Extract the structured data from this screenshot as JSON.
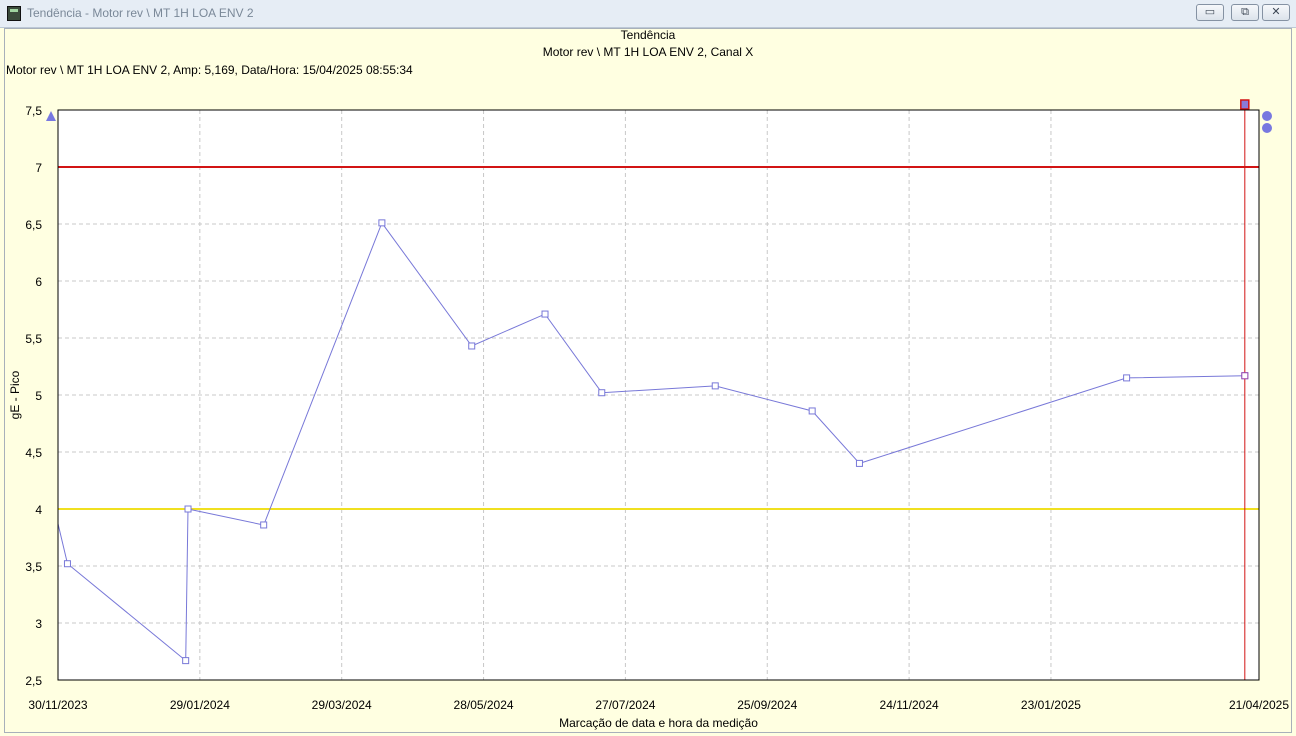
{
  "window": {
    "title": "Tendência - Motor rev \\ MT 1H LOA ENV 2",
    "minimize_glyph": "▭",
    "restore_glyph": "⧉",
    "close_glyph": "✕"
  },
  "header": {
    "title": "Tendência",
    "subtitle": "Motor rev \\ MT 1H LOA ENV 2, Canal X",
    "readout": "Motor rev \\ MT 1H LOA ENV 2, Amp: 5,169, Data/Hora: 15/04/2025 08:55:34"
  },
  "colors": {
    "background": "#FFFFE1",
    "plot_background": "#FFFFFF",
    "series": "#7878D8",
    "alarm_high": "#D21414",
    "alarm_warning": "#F0E020",
    "cursor": "#D21414",
    "grid": "#C8C8C8"
  },
  "chart_data": {
    "type": "line",
    "title": "Tendência",
    "subtitle": "Motor rev \\ MT 1H LOA ENV 2, Canal X",
    "xlabel": "Marcação de data e hora da medição",
    "ylabel": "gE - Pico",
    "xlim": [
      "2023-11-30",
      "2025-04-21"
    ],
    "ylim": [
      2.5,
      7.5
    ],
    "x_tick_labels": [
      "30/11/2023",
      "29/01/2024",
      "29/03/2024",
      "28/05/2024",
      "27/07/2024",
      "25/09/2024",
      "24/11/2024",
      "23/01/2025",
      "21/04/2025"
    ],
    "y_tick_labels": [
      "2,5",
      "3",
      "3,5",
      "4",
      "4,5",
      "5",
      "5,5",
      "6",
      "6,5",
      "7",
      "7,5"
    ],
    "grid": true,
    "series": [
      {
        "x": [
          "2023-11-30",
          "2023-12-04",
          "2024-01-23",
          "2024-01-24",
          "2024-02-25",
          "2024-04-15",
          "2024-05-23",
          "2024-06-23",
          "2024-07-17",
          "2024-09-03",
          "2024-10-14",
          "2024-11-03",
          "2025-02-24",
          "2025-04-15"
        ],
        "y": [
          3.87,
          3.52,
          2.67,
          4.0,
          3.86,
          6.51,
          5.43,
          5.71,
          5.02,
          5.08,
          4.86,
          4.4,
          5.15,
          5.169
        ]
      }
    ],
    "alarm_lines": [
      {
        "level": "alarm",
        "y": 7.0
      },
      {
        "level": "warning",
        "y": 4.0
      }
    ],
    "cursor": {
      "x": "2025-04-15",
      "y": 5.169
    }
  }
}
